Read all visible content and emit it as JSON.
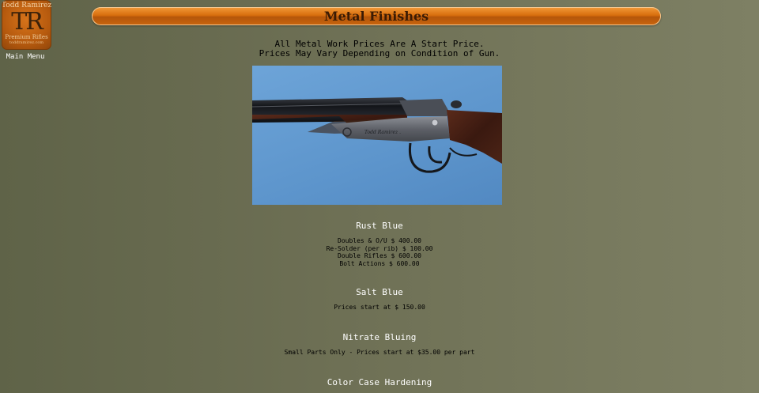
{
  "logo": {
    "line1": "Todd Ramirez",
    "monogram": "TR",
    "line2": "Premium Rifles",
    "line3": "toddramirez.com"
  },
  "nav": {
    "main_menu": "Main Menu"
  },
  "page": {
    "title": "Metal Finishes",
    "intro_line1": "All Metal Work Prices Are A Start Price.",
    "intro_line2": "Prices May Vary Depending on Condition of Gun."
  },
  "sections": [
    {
      "title": "Rust Blue",
      "lines": [
        "Doubles & O/U $ 400.00",
        "Re-Solder (per rib) $ 100.00",
        "Double Rifles $ 600.00",
        "Bolt Actions $ 600.00"
      ]
    },
    {
      "title": "Salt Blue",
      "lines": [
        "Prices start at $ 150.00"
      ]
    },
    {
      "title": "Nitrate Bluing",
      "lines": [
        "Small Parts Only - Prices start at $35.00 per part"
      ]
    },
    {
      "title": "Color Case Hardening",
      "lines": []
    }
  ],
  "image": {
    "engraving_text": "Todd Ramirez ."
  },
  "colors": {
    "title_bar": "#d86e0d",
    "title_text": "#3b1b04",
    "photo_background": "#5d95cc",
    "section_title": "#ffffff"
  }
}
